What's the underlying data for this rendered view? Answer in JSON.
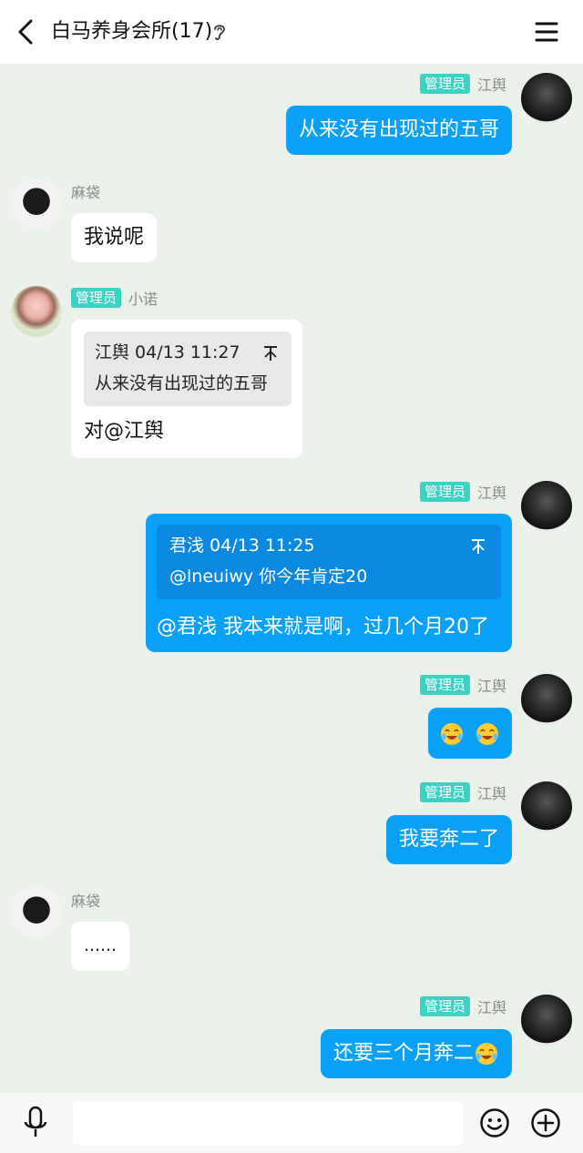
{
  "header": {
    "title": "白马养身会所(17)"
  },
  "messages": [
    {
      "side": "out",
      "badge": "管理员",
      "sender": "江舆",
      "text": "从来没有出现过的五哥"
    },
    {
      "side": "in",
      "sender": "麻袋",
      "text": "我说呢"
    },
    {
      "side": "in",
      "badge": "管理员",
      "sender": "小诺",
      "quote": {
        "meta": "江舆 04/13 11:27",
        "text": "从来没有出现过的五哥"
      },
      "text": "对@江舆"
    },
    {
      "side": "out",
      "badge": "管理员",
      "sender": "江舆",
      "quote": {
        "meta": "君浅 04/13 11:25",
        "text": "@lneuiwy 你今年肯定20"
      },
      "text": "@君浅 我本来就是啊，过几个月20了"
    },
    {
      "side": "out",
      "badge": "管理员",
      "sender": "江舆",
      "emoji": [
        "laughing-crying-emoji",
        "laughing-crying-emoji"
      ]
    },
    {
      "side": "out",
      "badge": "管理员",
      "sender": "江舆",
      "text": "我要奔二了"
    },
    {
      "side": "in",
      "sender": "麻袋",
      "text": "……"
    },
    {
      "side": "out",
      "badge": "管理员",
      "sender": "江舆",
      "text": "还要三个月奔二",
      "emoji": [
        "laughing-crying-emoji"
      ]
    }
  ],
  "colors": {
    "out_bubble": "#0aa0f5",
    "in_bubble": "#ffffff",
    "badge": "#3dd0c5",
    "background": "#eaf0ea"
  },
  "input": {
    "placeholder": ""
  }
}
